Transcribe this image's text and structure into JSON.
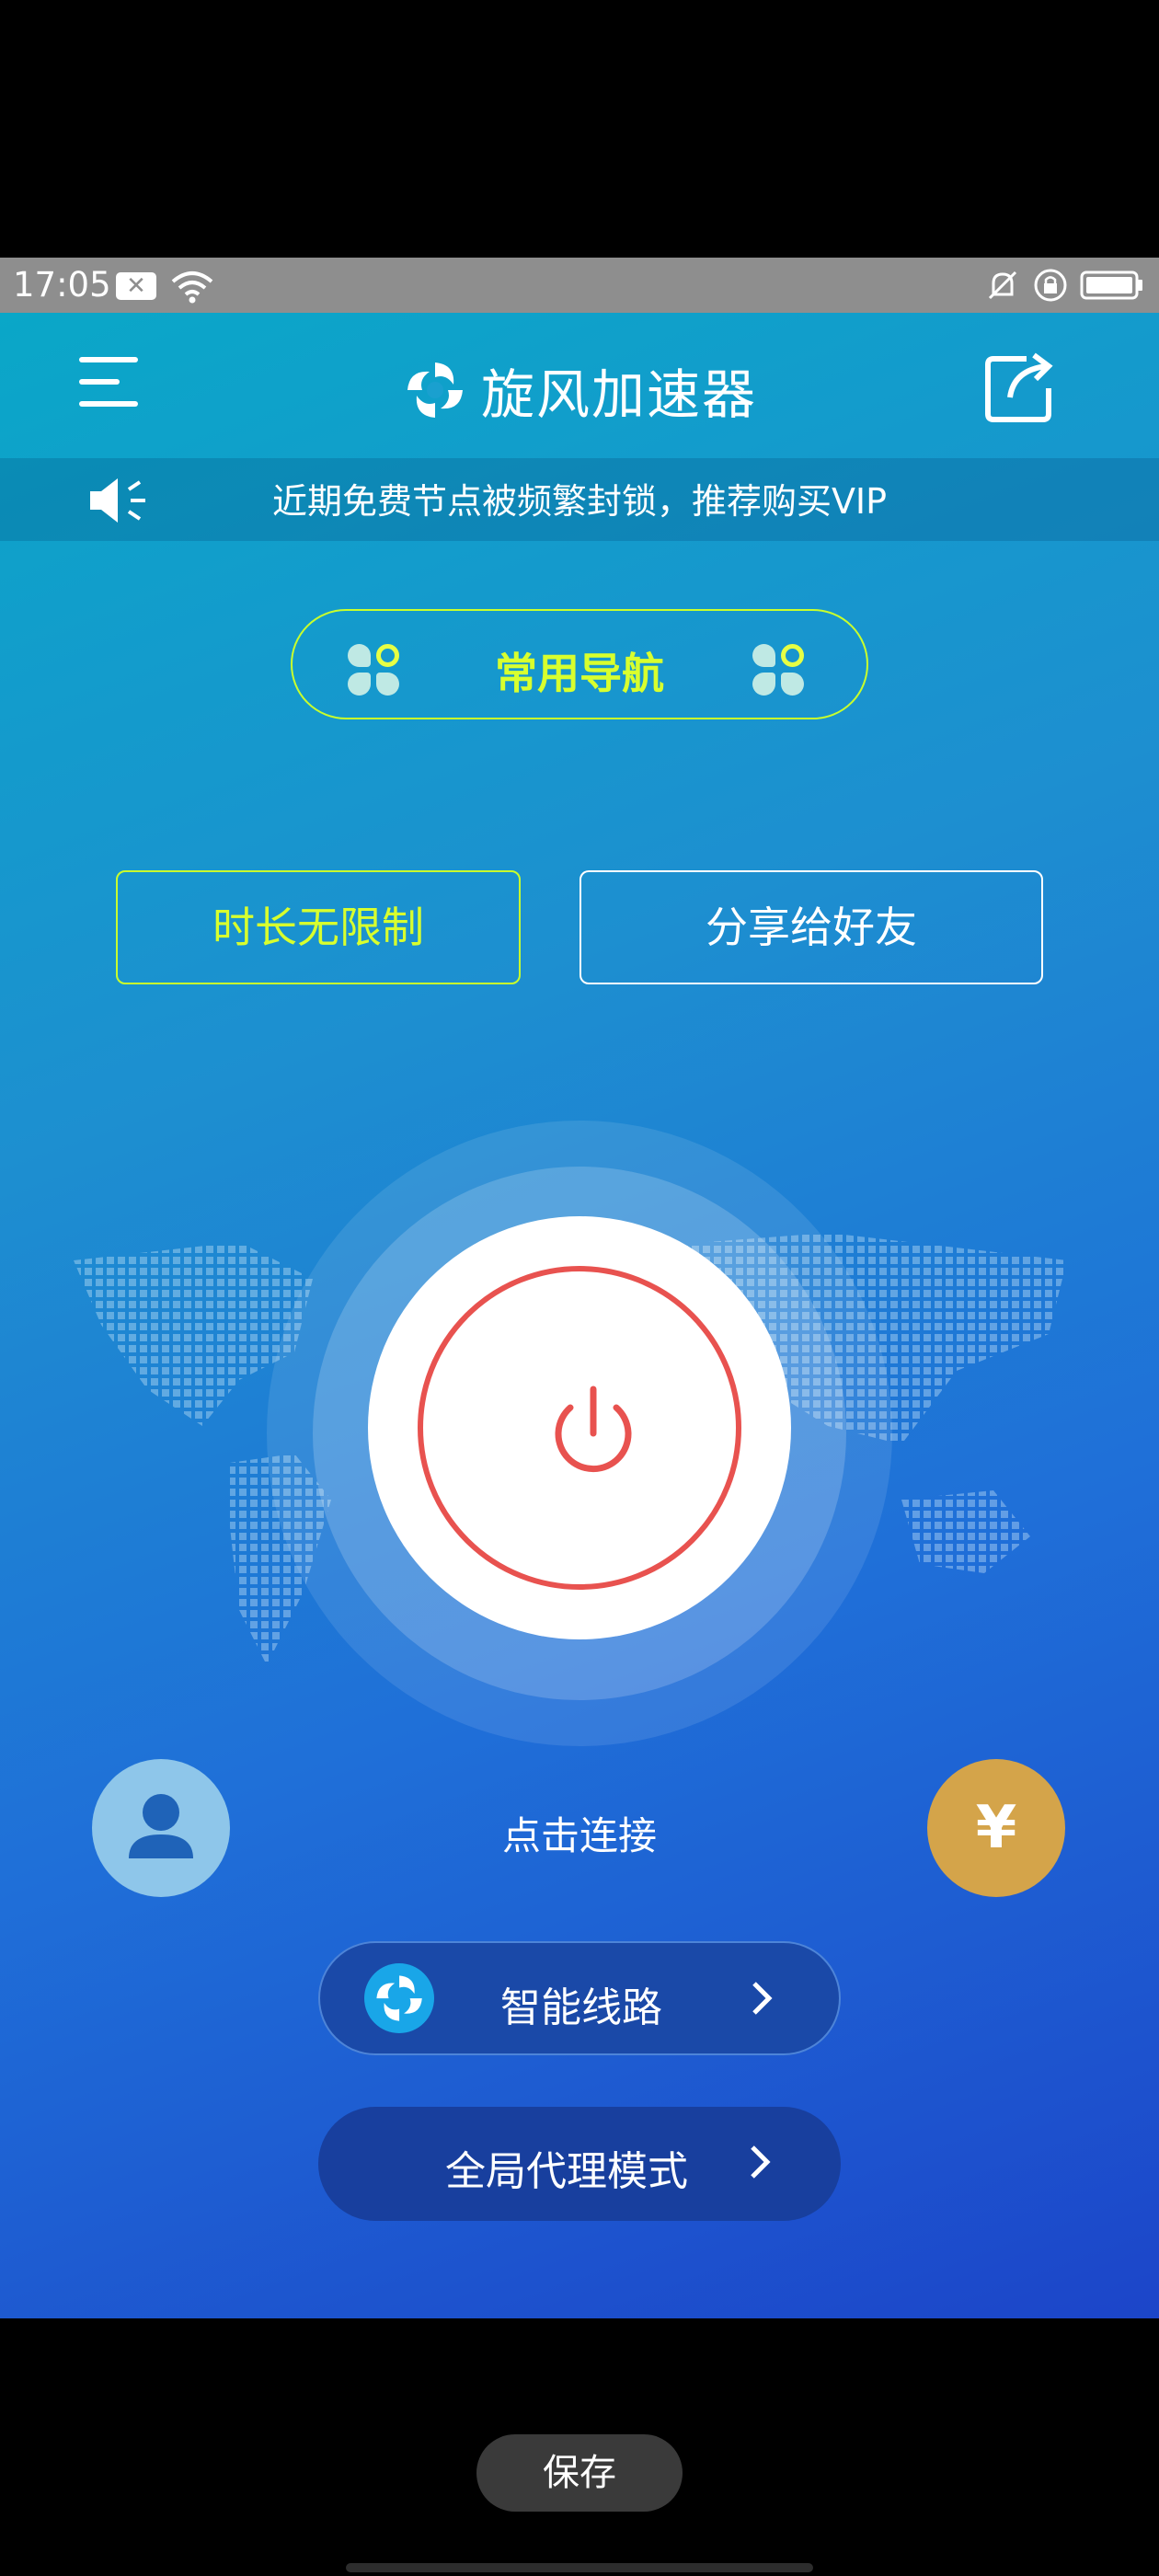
{
  "status_bar": {
    "time": "17:05",
    "notification_icon": "close-box-icon",
    "wifi_icon": "wifi-icon",
    "right_icons": [
      "bell-off-icon",
      "lock-rotation-icon",
      "battery-icon"
    ]
  },
  "header": {
    "menu_icon": "hamburger-menu-icon",
    "logo_icon": "swirl-logo-icon",
    "title": "旋风加速器",
    "share_icon": "share-external-icon"
  },
  "notice": {
    "icon": "speaker-icon",
    "text": "近期免费节点被频繁封锁，推荐购买VIP"
  },
  "nav": {
    "label": "常用导航",
    "icon": "clover-grid-icon"
  },
  "actions": {
    "unlimited_label": "时长无限制",
    "share_label": "分享给好友"
  },
  "power": {
    "icon": "power-icon",
    "connect_label": "点击连接"
  },
  "side_buttons": {
    "user_icon": "user-icon",
    "coin_symbol": "¥"
  },
  "route": {
    "label": "智能线路",
    "icon": "swirl-logo-icon"
  },
  "mode": {
    "label": "全局代理模式"
  },
  "footer": {
    "save_label": "保存"
  },
  "colors": {
    "accent_yellow": "#d8ff2e",
    "power_red": "#e8524f",
    "coin_gold": "#d4a44a",
    "gradient_top": "#0aa7c8",
    "gradient_bottom": "#1c45c9"
  }
}
